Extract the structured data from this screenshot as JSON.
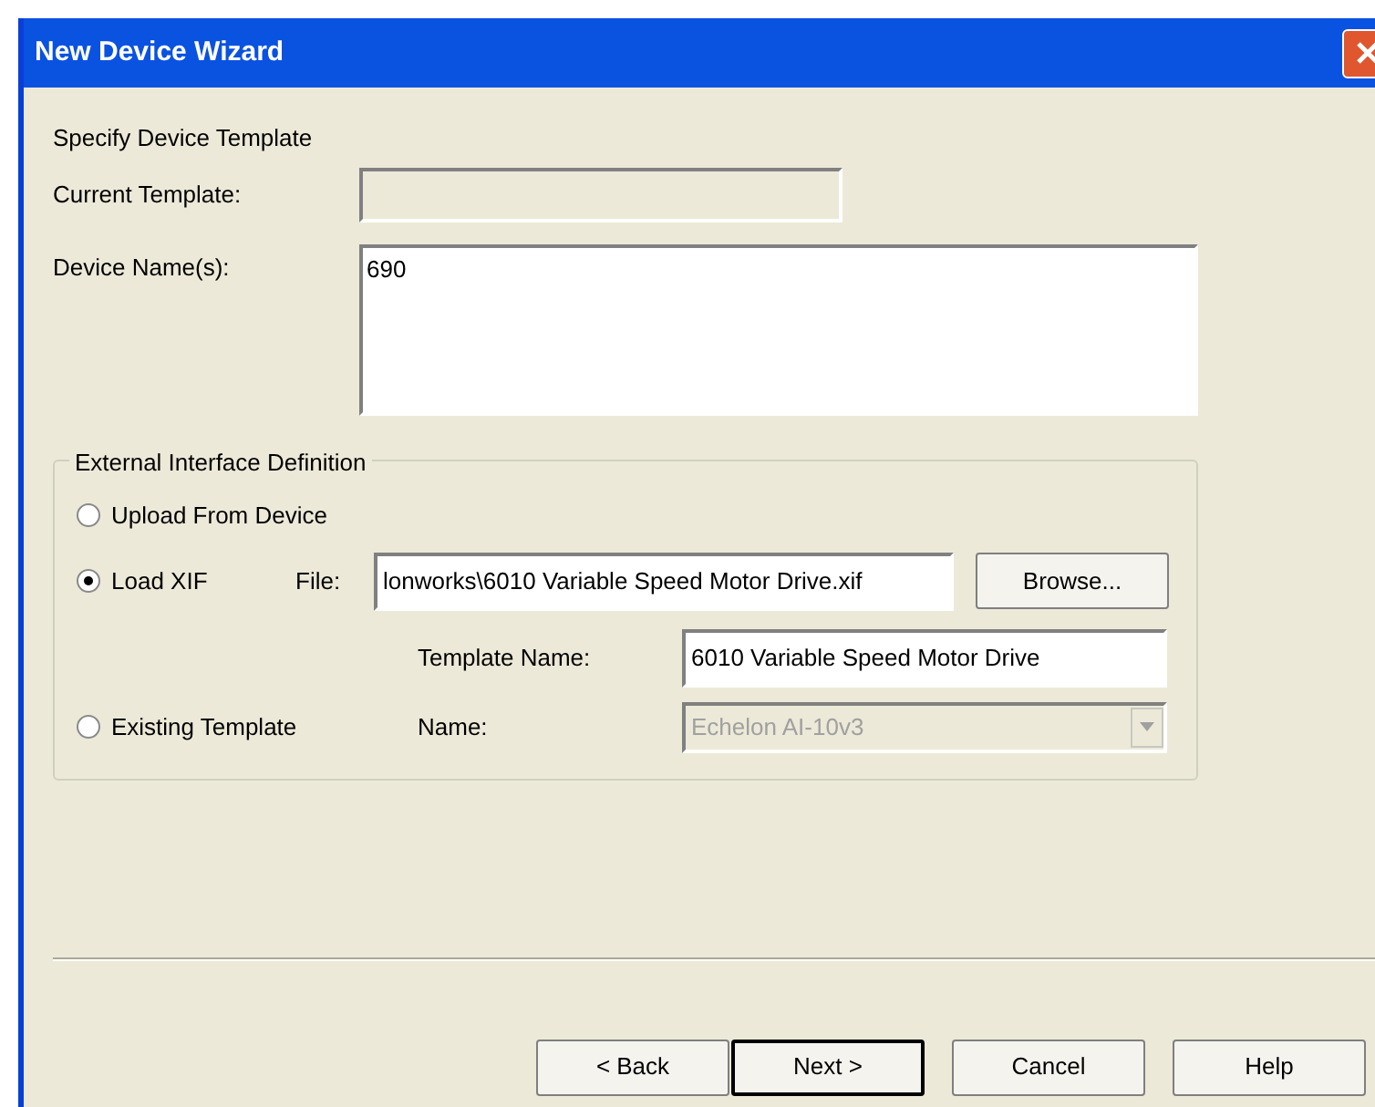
{
  "window": {
    "title": "New Device Wizard"
  },
  "heading": "Specify Device Template",
  "current_template": {
    "label": "Current Template:",
    "disabled": true
  },
  "device_names": {
    "label": "Device Name(s):",
    "value": "690"
  },
  "group": {
    "legend": "External Interface Definition",
    "options": [
      {
        "label": "Upload From Device",
        "selected": false
      },
      {
        "label": "Load XIF",
        "selected": true
      },
      {
        "label": "Existing Template",
        "selected": false
      }
    ],
    "file": {
      "label": "File:",
      "value": "lonworks\\6010 Variable Speed Motor Drive.xif"
    },
    "browse": "Browse...",
    "template_name": {
      "label": "Template Name:",
      "value": "6010 Variable Speed Motor Drive"
    },
    "name": {
      "label": "Name:",
      "value": "Echelon AI-10v3",
      "disabled": true
    }
  },
  "buttons": [
    {
      "label": "< Back",
      "default": false
    },
    {
      "label": "Next >",
      "default": true
    },
    {
      "label": "Cancel",
      "default": false
    },
    {
      "label": "Help",
      "default": false
    }
  ]
}
